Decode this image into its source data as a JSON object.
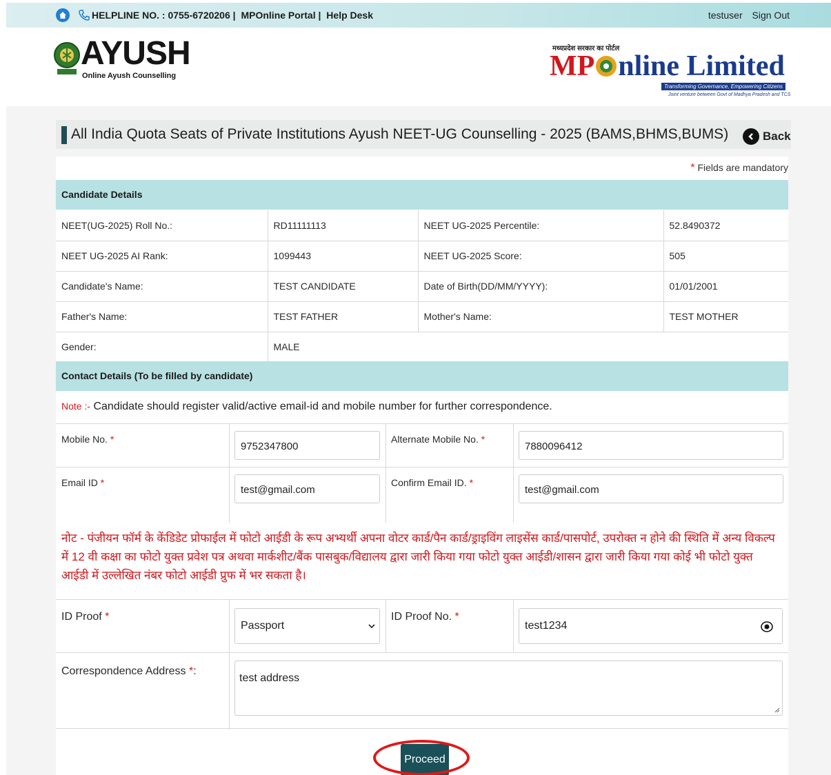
{
  "topbar": {
    "helpline": "HELPLINE NO. : 0755-6720206 |",
    "portal": "MPOnline Portal |",
    "helpdesk": "Help Desk",
    "username": "testuser",
    "signout": "Sign Out"
  },
  "logos": {
    "ayush_title": "AYUSH",
    "ayush_sub": "Online Ayush Counselling",
    "mp_hindi": "मध्यप्रदेश सरकार का पोर्टल",
    "mp_mp": "MP",
    "mp_rest": "nline Limited",
    "mp_tagline": "Transforming Governance, Empowering Citizens",
    "mp_jv": "Joint venture between Govt of Madhya Pradesh and TCS"
  },
  "page": {
    "title": "All India Quota Seats of Private Institutions Ayush NEET-UG Counselling - 2025 (BAMS,BHMS,BUMS)",
    "back_label": "Back",
    "mandatory_note": "Fields are mandatory",
    "mandatory_star": "*"
  },
  "candidate": {
    "section_title": "Candidate Details",
    "rows": [
      {
        "l1": "NEET(UG-2025) Roll No.:",
        "v1": "RD11111113",
        "l2": "NEET UG-2025 Percentile:",
        "v2": "52.8490372"
      },
      {
        "l1": "NEET UG-2025 AI Rank:",
        "v1": "1099443",
        "l2": "NEET UG-2025 Score:",
        "v2": "505"
      },
      {
        "l1": "Candidate's Name:",
        "v1": "TEST CANDIDATE",
        "l2": "Date of Birth(DD/MM/YYYY):",
        "v2": "01/01/2001"
      },
      {
        "l1": "Father's Name:",
        "v1": "TEST FATHER",
        "l2": "Mother's Name:",
        "v2": "TEST MOTHER"
      },
      {
        "l1": "Gender:",
        "v1": "MALE",
        "l2": "",
        "v2": ""
      }
    ]
  },
  "contact": {
    "section_title": "Contact Details (To be filled by candidate)",
    "note_label": "Note :-",
    "note_text": " Candidate should register valid/active email-id and mobile number for further correspondence.",
    "mobile_label": "Mobile No.",
    "mobile_value": "9752347800",
    "alt_mobile_label": "Alternate Mobile No.",
    "alt_mobile_value": "7880096412",
    "email_label": "Email ID",
    "email_value": "test@gmail.com",
    "confirm_email_label": "Confirm Email ID.",
    "confirm_email_value": "test@gmail.com",
    "hindi_note": "नोट - पंजीयन फॉर्म के केंडिडेट प्रोफाईल में फोटो आईडी के रूप अभ्यर्थी अपना वोटर कार्ड/पैन कार्ड/ड्राइविंग लाइसेंस कार्ड/पासपोर्ट, उपरोक्त न होने की स्थिति में अन्य विकल्प में 12 वी कक्षा का फोटो युक्त प्रवेश पत्र अथवा मार्कशीट/बैंक पासबुक/विद्यालय द्वारा जारी किया गया फोटो युक्त आईडी/शासन द्वारा जारी किया गया कोई भी फोटो युक्त आईडी में उल्लेखित नंबर फोटो आईडी प्रुफ में भर सकता है।",
    "id_proof_label": "ID Proof",
    "id_proof_value": "Passport",
    "id_proof_no_label": "ID Proof No.",
    "id_proof_no_value": "test1234",
    "address_label": "Correspondence Address",
    "address_suffix": ":",
    "address_value": "test address",
    "required_star": "*"
  },
  "actions": {
    "proceed_label": "Proceed"
  },
  "colors": {
    "section_bg": "#b8e1e3",
    "accent_dark": "#1a5058",
    "required_red": "#d0171c"
  }
}
